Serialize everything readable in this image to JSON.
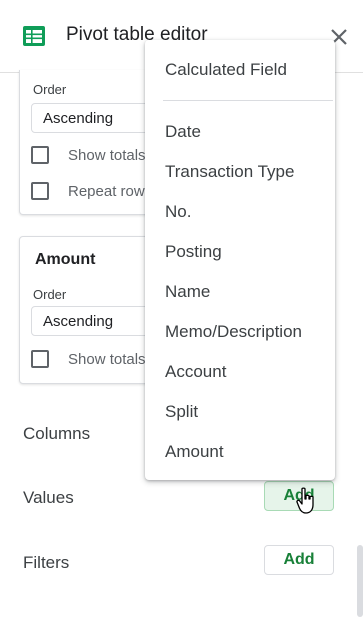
{
  "header": {
    "title": "Pivot table editor",
    "app_icon": "sheets-icon",
    "close_icon": "close-icon"
  },
  "rows_card": {
    "order_label": "Order",
    "order_value": "Ascending",
    "show_totals": "Show totals",
    "repeat_row": "Repeat row"
  },
  "amount_card": {
    "title": "Amount",
    "order_label": "Order",
    "order_value": "Ascending",
    "show_totals": "Show totals"
  },
  "sections": {
    "columns": "Columns",
    "values": "Values",
    "filters": "Filters",
    "add_label": "Add"
  },
  "menu": {
    "calculated_field": "Calculated Field",
    "items": [
      "Date",
      "Transaction Type",
      "No.",
      "Posting",
      "Name",
      "Memo/Description",
      "Account",
      "Split",
      "Amount"
    ]
  },
  "colors": {
    "accent_green": "#188038",
    "sheets_green": "#0f9d58"
  }
}
